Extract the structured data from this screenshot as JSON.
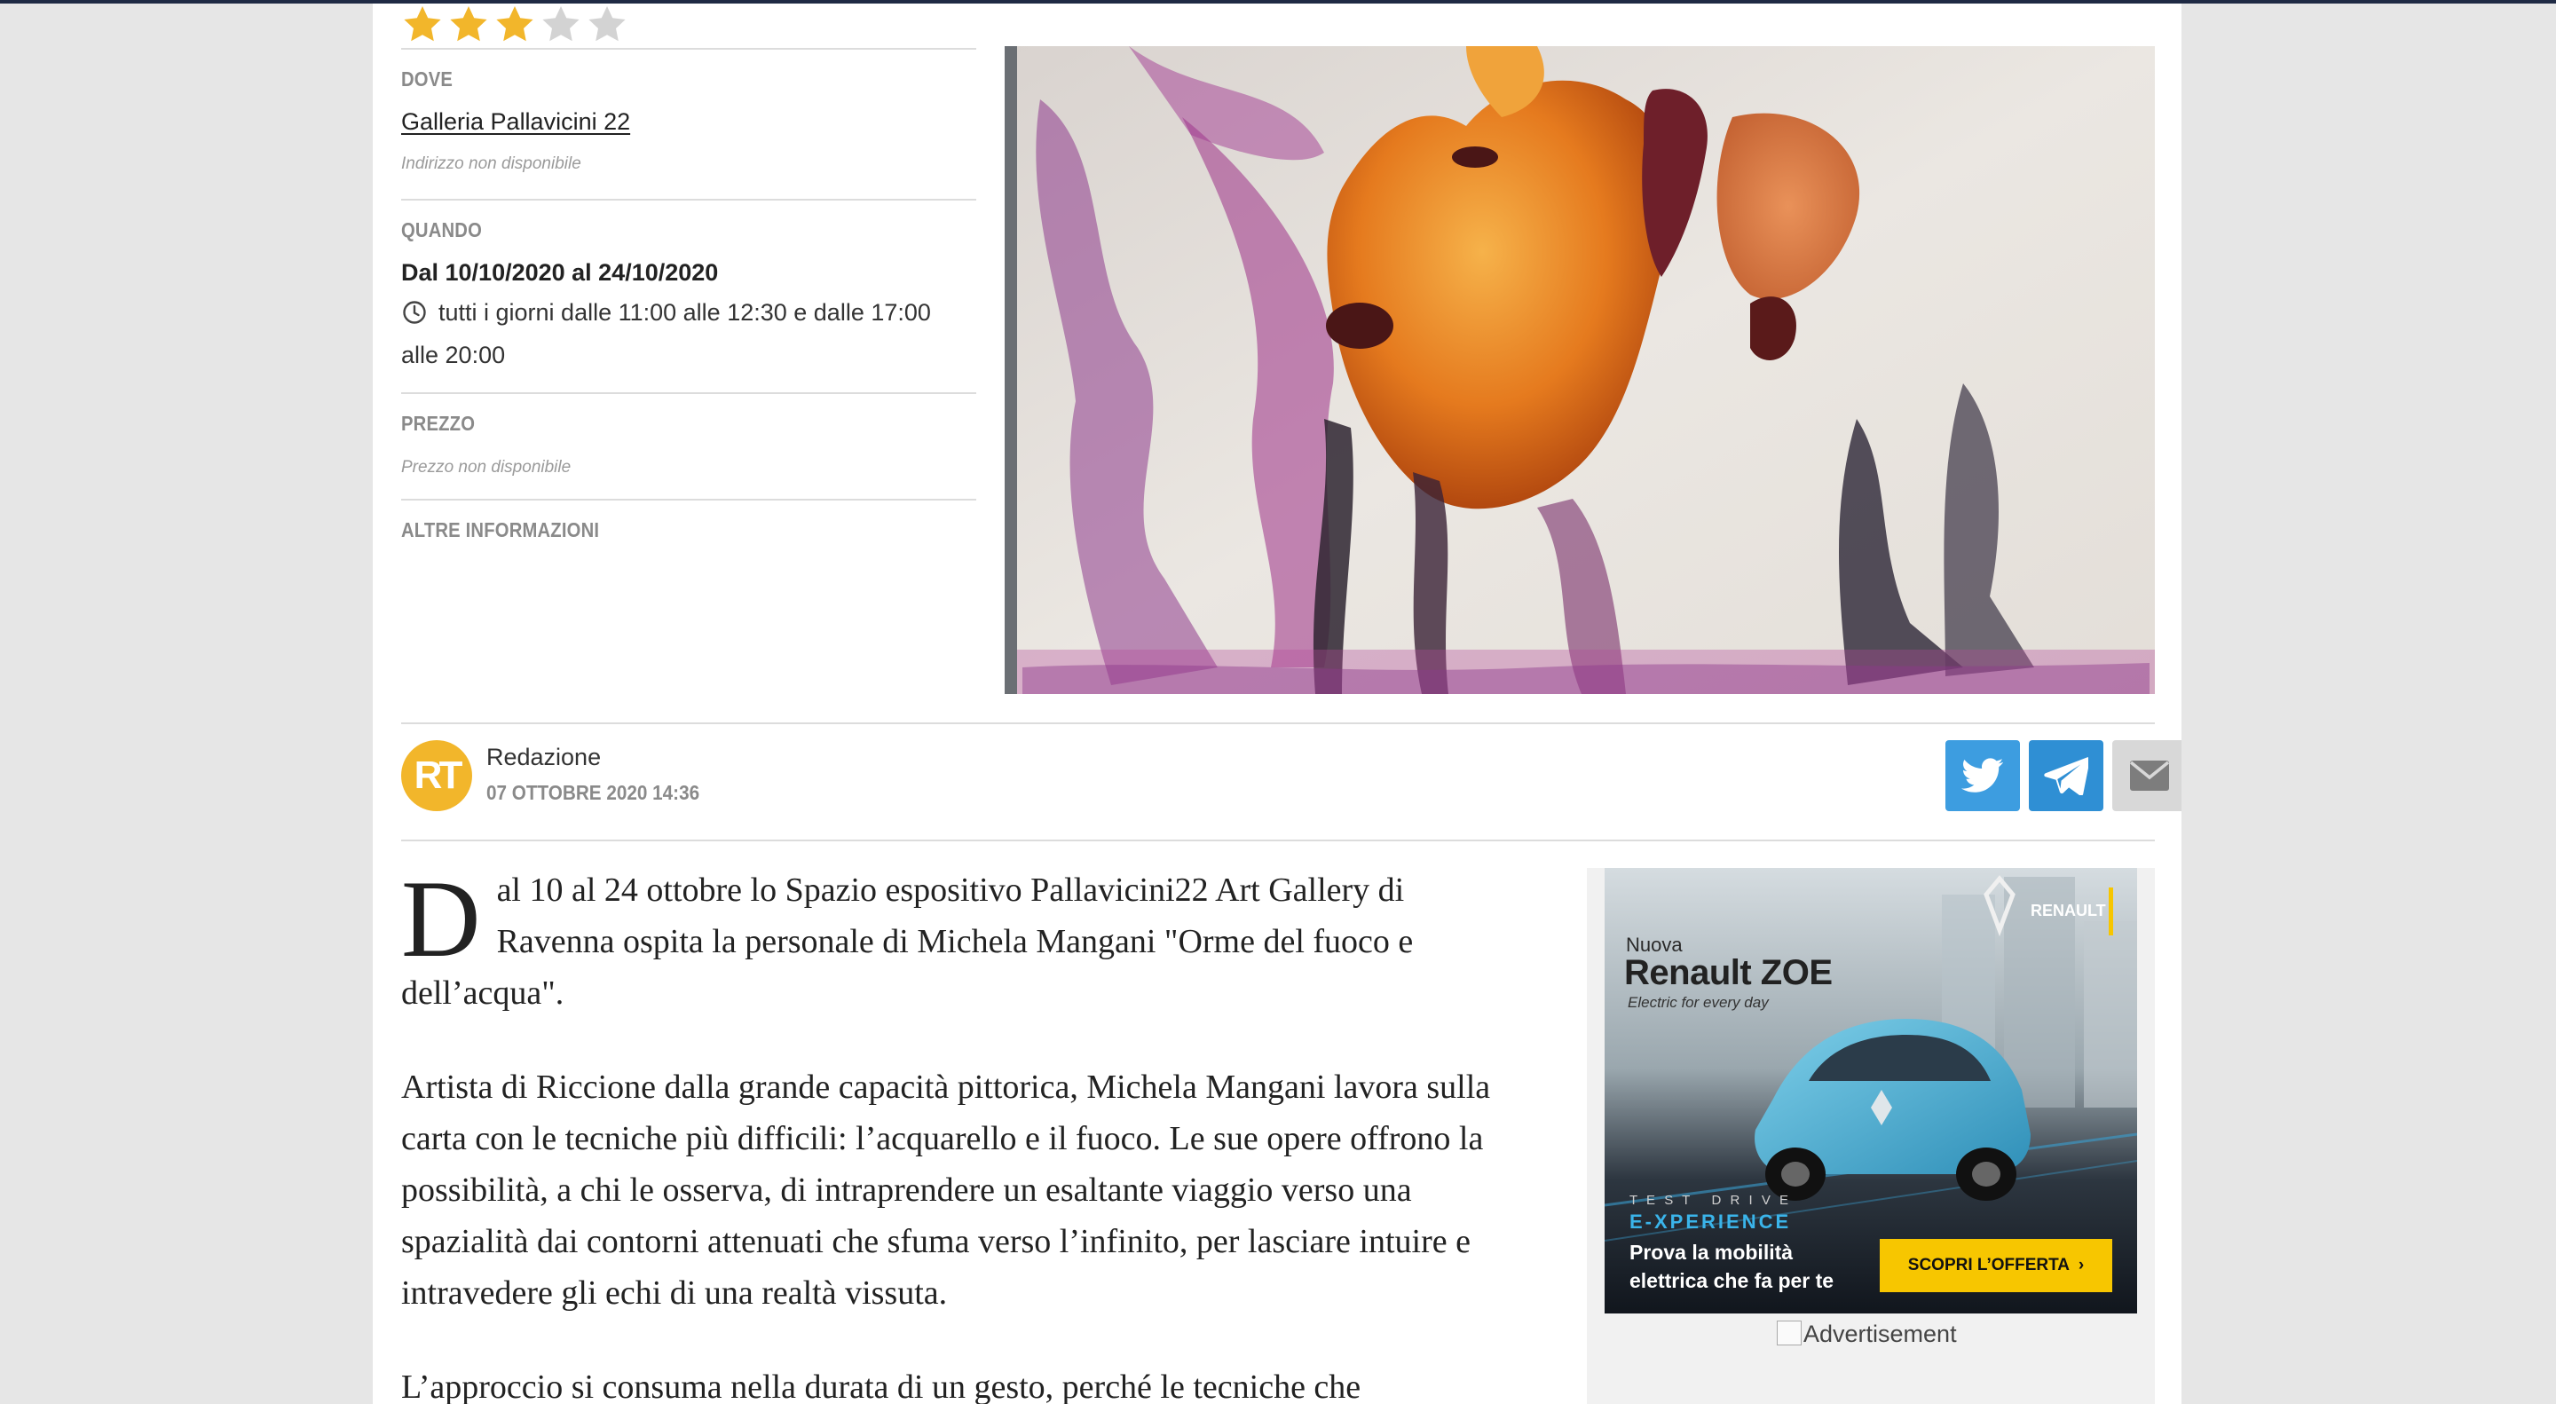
{
  "event": {
    "rating": {
      "value": 3,
      "max": 5
    },
    "where": {
      "label": "DOVE",
      "venue": "Galleria Pallavicini 22",
      "address": "Indirizzo non disponibile"
    },
    "when": {
      "label": "QUANDO",
      "dates": "Dal 10/10/2020 al 24/10/2020",
      "hours_line1": "tutti i giorni dalle 11:00 alle 12:30 e dalle 17:00",
      "hours_line2": "alle 20:00"
    },
    "price": {
      "label": "PREZZO",
      "value": "Prezzo non disponibile"
    },
    "other": {
      "label": "ALTRE INFORMAZIONI"
    }
  },
  "author": {
    "initials": "RT",
    "name": "Redazione",
    "date": "07 OTTOBRE 2020 14:36"
  },
  "article": {
    "dropcap": "D",
    "p1_rest": "al 10 al 24 ottobre lo Spazio espositivo Pallavicini22 Art Gallery di Ravenna ospita la personale di Michela Mangani \"Orme del fuoco e dell’acqua\".",
    "p2": "Artista di Riccione dalla grande capacità pittorica, Michela Mangani lavora sulla carta con le tecniche più difficili: l’acquarello e il fuoco. Le sue opere offrono la possibilità, a chi le osserva, di intraprendere un esaltante viaggio verso una spazialità dai contorni attenuati che sfuma verso l’infinito, per lasciare intuire e intravedere gli echi di una realtà vissuta.",
    "p3": "L’approccio si consuma nella durata di un gesto, perché le tecniche che"
  },
  "ad": {
    "nuova": "Nuova",
    "model": "Renault ZOE",
    "tagline": "Electric for every day",
    "brand": "RENAULT",
    "test_drive": "T E S T   D R I V E",
    "experience": "E-XPERIENCE",
    "promo_line1": "Prova la mobilità",
    "promo_line2": "elettrica che fa per te",
    "cta": "SCOPRI L’OFFERTA  ›",
    "caption": "Advertisement"
  },
  "colors": {
    "star_on": "#f2b62b",
    "star_off": "#d3d3d3",
    "twitter": "#3d9de0",
    "telegram": "#2f8fd4",
    "email": "#d8d8d8",
    "avatar": "#f2b62b",
    "ad_cta": "#f7c600"
  }
}
